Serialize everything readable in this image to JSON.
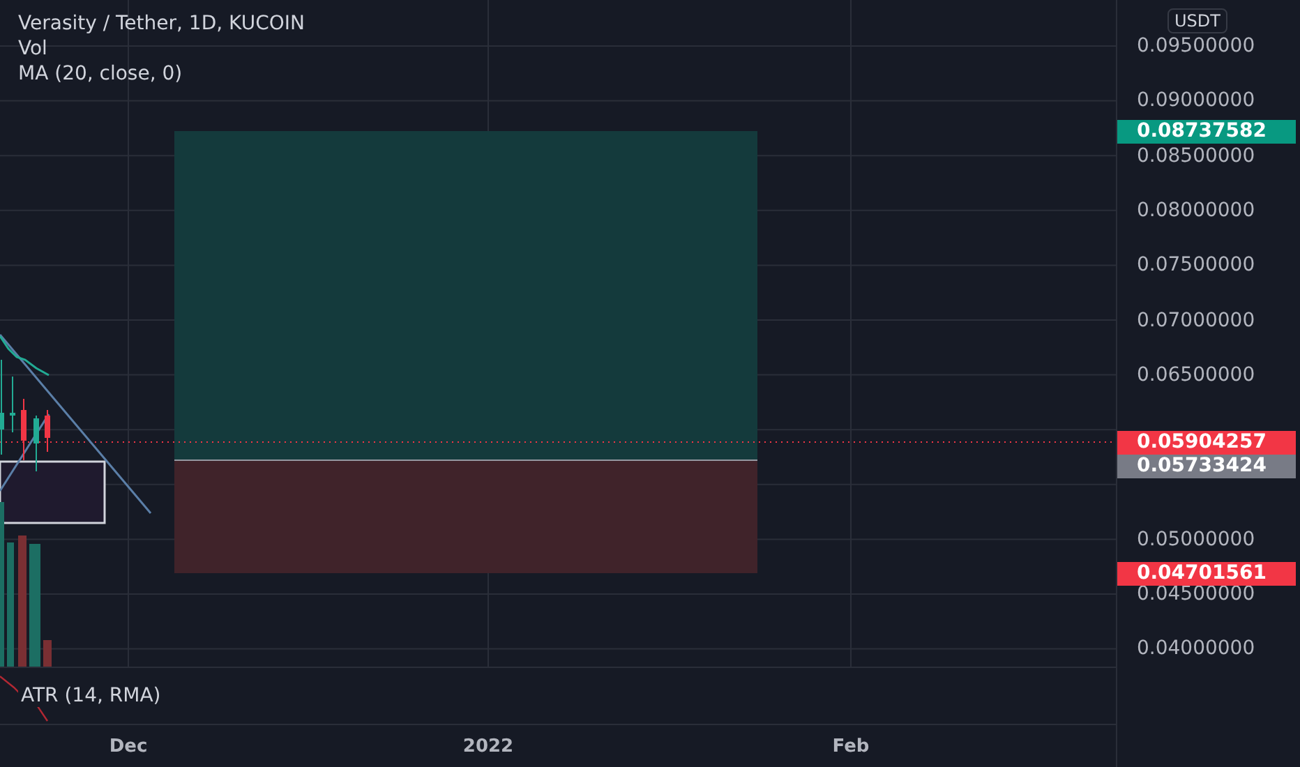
{
  "legend": {
    "title": "Verasity / Tether, 1D, KUCOIN",
    "indicators": [
      "Vol",
      "MA (20, close, 0)"
    ]
  },
  "price_axis": {
    "currency": "USDT",
    "ticks": [
      "0.09500000",
      "0.09000000",
      "0.08500000",
      "0.08000000",
      "0.07500000",
      "0.07000000",
      "0.06500000",
      "0.05000000",
      "0.04500000",
      "0.04000000"
    ],
    "markers": [
      {
        "label": "0.08737582",
        "color": "#089981"
      },
      {
        "label": "0.05904257",
        "color": "#f23645"
      },
      {
        "label": "0.05733424",
        "color": "#787b86"
      },
      {
        "label": "0.04701561",
        "color": "#f23645"
      }
    ]
  },
  "atr_pane": {
    "label": "ATR (14, RMA)"
  },
  "time_axis": {
    "labels": [
      "Dec",
      "2022",
      "Feb"
    ]
  }
}
